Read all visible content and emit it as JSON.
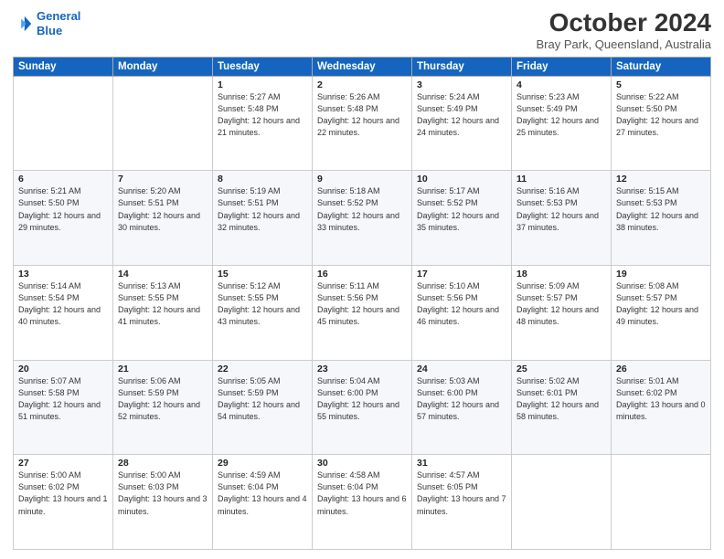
{
  "logo": {
    "line1": "General",
    "line2": "Blue"
  },
  "header": {
    "title": "October 2024",
    "location": "Bray Park, Queensland, Australia"
  },
  "weekdays": [
    "Sunday",
    "Monday",
    "Tuesday",
    "Wednesday",
    "Thursday",
    "Friday",
    "Saturday"
  ],
  "weeks": [
    [
      {
        "day": "",
        "sunrise": "",
        "sunset": "",
        "daylight": ""
      },
      {
        "day": "",
        "sunrise": "",
        "sunset": "",
        "daylight": ""
      },
      {
        "day": "1",
        "sunrise": "Sunrise: 5:27 AM",
        "sunset": "Sunset: 5:48 PM",
        "daylight": "Daylight: 12 hours and 21 minutes."
      },
      {
        "day": "2",
        "sunrise": "Sunrise: 5:26 AM",
        "sunset": "Sunset: 5:48 PM",
        "daylight": "Daylight: 12 hours and 22 minutes."
      },
      {
        "day": "3",
        "sunrise": "Sunrise: 5:24 AM",
        "sunset": "Sunset: 5:49 PM",
        "daylight": "Daylight: 12 hours and 24 minutes."
      },
      {
        "day": "4",
        "sunrise": "Sunrise: 5:23 AM",
        "sunset": "Sunset: 5:49 PM",
        "daylight": "Daylight: 12 hours and 25 minutes."
      },
      {
        "day": "5",
        "sunrise": "Sunrise: 5:22 AM",
        "sunset": "Sunset: 5:50 PM",
        "daylight": "Daylight: 12 hours and 27 minutes."
      }
    ],
    [
      {
        "day": "6",
        "sunrise": "Sunrise: 5:21 AM",
        "sunset": "Sunset: 5:50 PM",
        "daylight": "Daylight: 12 hours and 29 minutes."
      },
      {
        "day": "7",
        "sunrise": "Sunrise: 5:20 AM",
        "sunset": "Sunset: 5:51 PM",
        "daylight": "Daylight: 12 hours and 30 minutes."
      },
      {
        "day": "8",
        "sunrise": "Sunrise: 5:19 AM",
        "sunset": "Sunset: 5:51 PM",
        "daylight": "Daylight: 12 hours and 32 minutes."
      },
      {
        "day": "9",
        "sunrise": "Sunrise: 5:18 AM",
        "sunset": "Sunset: 5:52 PM",
        "daylight": "Daylight: 12 hours and 33 minutes."
      },
      {
        "day": "10",
        "sunrise": "Sunrise: 5:17 AM",
        "sunset": "Sunset: 5:52 PM",
        "daylight": "Daylight: 12 hours and 35 minutes."
      },
      {
        "day": "11",
        "sunrise": "Sunrise: 5:16 AM",
        "sunset": "Sunset: 5:53 PM",
        "daylight": "Daylight: 12 hours and 37 minutes."
      },
      {
        "day": "12",
        "sunrise": "Sunrise: 5:15 AM",
        "sunset": "Sunset: 5:53 PM",
        "daylight": "Daylight: 12 hours and 38 minutes."
      }
    ],
    [
      {
        "day": "13",
        "sunrise": "Sunrise: 5:14 AM",
        "sunset": "Sunset: 5:54 PM",
        "daylight": "Daylight: 12 hours and 40 minutes."
      },
      {
        "day": "14",
        "sunrise": "Sunrise: 5:13 AM",
        "sunset": "Sunset: 5:55 PM",
        "daylight": "Daylight: 12 hours and 41 minutes."
      },
      {
        "day": "15",
        "sunrise": "Sunrise: 5:12 AM",
        "sunset": "Sunset: 5:55 PM",
        "daylight": "Daylight: 12 hours and 43 minutes."
      },
      {
        "day": "16",
        "sunrise": "Sunrise: 5:11 AM",
        "sunset": "Sunset: 5:56 PM",
        "daylight": "Daylight: 12 hours and 45 minutes."
      },
      {
        "day": "17",
        "sunrise": "Sunrise: 5:10 AM",
        "sunset": "Sunset: 5:56 PM",
        "daylight": "Daylight: 12 hours and 46 minutes."
      },
      {
        "day": "18",
        "sunrise": "Sunrise: 5:09 AM",
        "sunset": "Sunset: 5:57 PM",
        "daylight": "Daylight: 12 hours and 48 minutes."
      },
      {
        "day": "19",
        "sunrise": "Sunrise: 5:08 AM",
        "sunset": "Sunset: 5:57 PM",
        "daylight": "Daylight: 12 hours and 49 minutes."
      }
    ],
    [
      {
        "day": "20",
        "sunrise": "Sunrise: 5:07 AM",
        "sunset": "Sunset: 5:58 PM",
        "daylight": "Daylight: 12 hours and 51 minutes."
      },
      {
        "day": "21",
        "sunrise": "Sunrise: 5:06 AM",
        "sunset": "Sunset: 5:59 PM",
        "daylight": "Daylight: 12 hours and 52 minutes."
      },
      {
        "day": "22",
        "sunrise": "Sunrise: 5:05 AM",
        "sunset": "Sunset: 5:59 PM",
        "daylight": "Daylight: 12 hours and 54 minutes."
      },
      {
        "day": "23",
        "sunrise": "Sunrise: 5:04 AM",
        "sunset": "Sunset: 6:00 PM",
        "daylight": "Daylight: 12 hours and 55 minutes."
      },
      {
        "day": "24",
        "sunrise": "Sunrise: 5:03 AM",
        "sunset": "Sunset: 6:00 PM",
        "daylight": "Daylight: 12 hours and 57 minutes."
      },
      {
        "day": "25",
        "sunrise": "Sunrise: 5:02 AM",
        "sunset": "Sunset: 6:01 PM",
        "daylight": "Daylight: 12 hours and 58 minutes."
      },
      {
        "day": "26",
        "sunrise": "Sunrise: 5:01 AM",
        "sunset": "Sunset: 6:02 PM",
        "daylight": "Daylight: 13 hours and 0 minutes."
      }
    ],
    [
      {
        "day": "27",
        "sunrise": "Sunrise: 5:00 AM",
        "sunset": "Sunset: 6:02 PM",
        "daylight": "Daylight: 13 hours and 1 minute."
      },
      {
        "day": "28",
        "sunrise": "Sunrise: 5:00 AM",
        "sunset": "Sunset: 6:03 PM",
        "daylight": "Daylight: 13 hours and 3 minutes."
      },
      {
        "day": "29",
        "sunrise": "Sunrise: 4:59 AM",
        "sunset": "Sunset: 6:04 PM",
        "daylight": "Daylight: 13 hours and 4 minutes."
      },
      {
        "day": "30",
        "sunrise": "Sunrise: 4:58 AM",
        "sunset": "Sunset: 6:04 PM",
        "daylight": "Daylight: 13 hours and 6 minutes."
      },
      {
        "day": "31",
        "sunrise": "Sunrise: 4:57 AM",
        "sunset": "Sunset: 6:05 PM",
        "daylight": "Daylight: 13 hours and 7 minutes."
      },
      {
        "day": "",
        "sunrise": "",
        "sunset": "",
        "daylight": ""
      },
      {
        "day": "",
        "sunrise": "",
        "sunset": "",
        "daylight": ""
      }
    ]
  ]
}
